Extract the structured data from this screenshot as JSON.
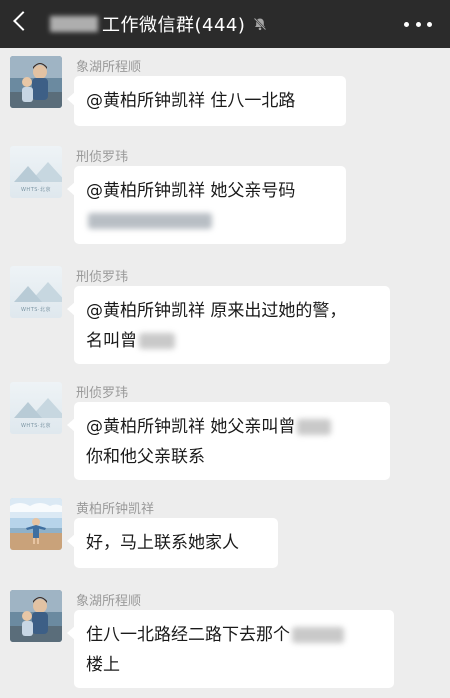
{
  "header": {
    "title": "工作微信群(444)",
    "icons": [
      "back-icon",
      "mute-icon",
      "more-icon"
    ]
  },
  "messages": [
    {
      "sender": "象湖所程顺",
      "avatar": "photo-avatar-mother-child",
      "lines": [
        "@黄柏所钟凯祥  住八一北路"
      ]
    },
    {
      "sender": "刑侦罗玮",
      "avatar": "landscape-avatar",
      "lines": [
        "@黄柏所钟凯祥  她父亲号码",
        ""
      ]
    },
    {
      "sender": "刑侦罗玮",
      "avatar": "landscape-avatar",
      "lines": [
        "@黄柏所钟凯祥  原来出过她的警，",
        "名叫曾"
      ]
    },
    {
      "sender": "刑侦罗玮",
      "avatar": "landscape-avatar",
      "lines": [
        "@黄柏所钟凯祥  她父亲叫曾",
        "你和他父亲联系"
      ]
    },
    {
      "sender": "黄柏所钟凯祥",
      "avatar": "photo-avatar-beach",
      "lines": [
        "好，马上联系她家人"
      ]
    },
    {
      "sender": "象湖所程顺",
      "avatar": "photo-avatar-mother-child",
      "lines": [
        "住八一北路经二路下去那个",
        "楼上"
      ]
    }
  ],
  "avatar_caption": "WHTS·北京"
}
